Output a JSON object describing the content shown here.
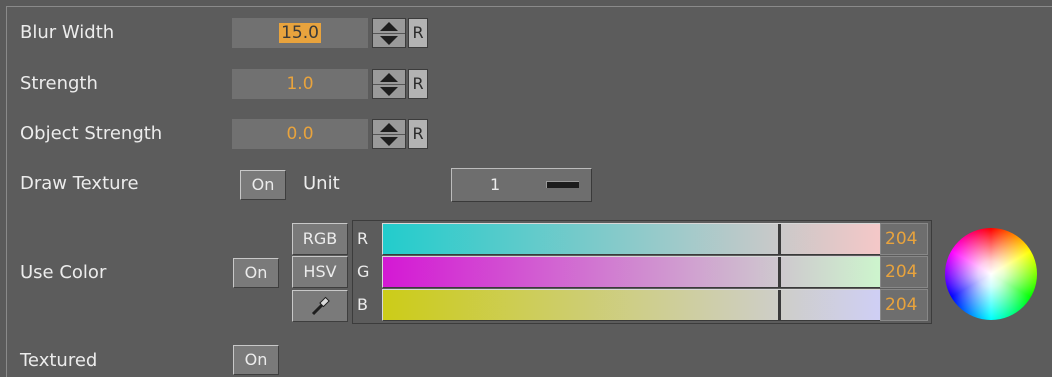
{
  "rows": {
    "blur_width": {
      "label": "Blur Width",
      "value": "15.0",
      "reset": "R"
    },
    "strength": {
      "label": "Strength",
      "value": "1.0",
      "reset": "R"
    },
    "object_strength": {
      "label": "Object Strength",
      "value": "0.0",
      "reset": "R"
    },
    "draw_texture": {
      "label": "Draw Texture",
      "toggle": "On",
      "unit_label": "Unit",
      "unit_value": "1"
    },
    "use_color": {
      "label": "Use Color",
      "toggle": "On",
      "modes": [
        "RGB",
        "HSV"
      ],
      "channels": [
        {
          "letter": "R",
          "value": "204",
          "colors": [
            "#22cccc",
            "#f5c8c8"
          ]
        },
        {
          "letter": "G",
          "value": "204",
          "colors": [
            "#d418d4",
            "#cdf5cd"
          ]
        },
        {
          "letter": "B",
          "value": "204",
          "colors": [
            "#cccc18",
            "#cfcff5"
          ]
        }
      ]
    },
    "textured": {
      "label": "Textured",
      "toggle": "On"
    }
  },
  "colors": {
    "value_text": "#e8a33d",
    "panel": "#5c5c5c"
  },
  "icons": {
    "spinner": "up-down-arrows-icon",
    "picker": "eyedropper-icon",
    "wheel": "color-wheel-icon"
  }
}
